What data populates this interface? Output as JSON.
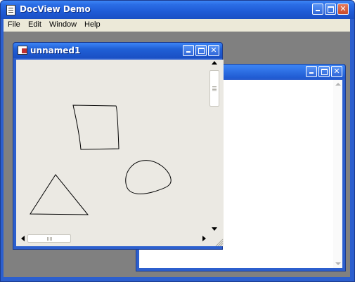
{
  "app": {
    "title": "DocView Demo"
  },
  "menu": {
    "items": [
      "File",
      "Edit",
      "Window",
      "Help"
    ]
  },
  "document": {
    "title": "unnamed1"
  },
  "icons": {
    "app": "document-icon",
    "doc": "mdi-document-icon",
    "minimize": "minimize-icon",
    "maximize": "maximize-icon",
    "close": "close-icon"
  },
  "colors": {
    "titlebar": "#2b6ee6",
    "canvas": "#ebe9e3",
    "mdi_background": "#808080"
  }
}
